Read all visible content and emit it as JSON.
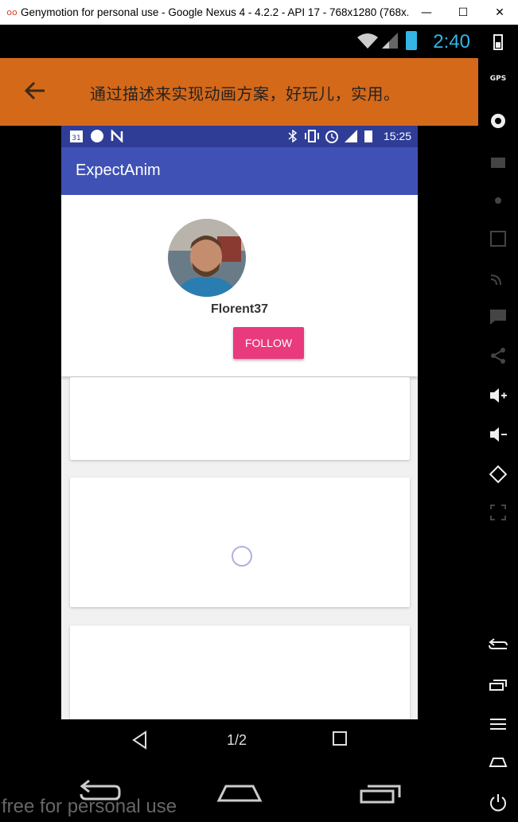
{
  "window": {
    "title": "Genymotion for personal use - Google Nexus 4 - 4.2.2 - API 17 - 768x1280 (768x...",
    "minimize_icon": "minimize-icon",
    "maximize_icon": "maximize-icon",
    "close_icon": "close-icon"
  },
  "host_status": {
    "time": "2:40"
  },
  "app_bar": {
    "title": "通过描述来实现动画方案，好玩儿，实用。",
    "back_icon": "arrow-left-icon",
    "color": "#d4691a"
  },
  "phone": {
    "status_time": "15:25",
    "toolbar_title": "ExpectAnim",
    "toolbar_color": "#3f51b5",
    "profile": {
      "name": "Florent37",
      "follow_label": "FOLLOW",
      "follow_color": "#e83a7d"
    },
    "page_indicator": "1/2"
  },
  "sidebar_icons": [
    "battery-icon",
    "gps-icon",
    "camera-icon",
    "video-icon",
    "dpad-icon",
    "id-icon",
    "cast-icon",
    "message-icon",
    "share-icon",
    "volume-up-icon",
    "volume-down-icon",
    "rotate-icon",
    "scale-icon",
    "back-icon",
    "recents-icon",
    "menu-icon",
    "home-icon",
    "power-icon"
  ],
  "watermark": "free for personal use"
}
